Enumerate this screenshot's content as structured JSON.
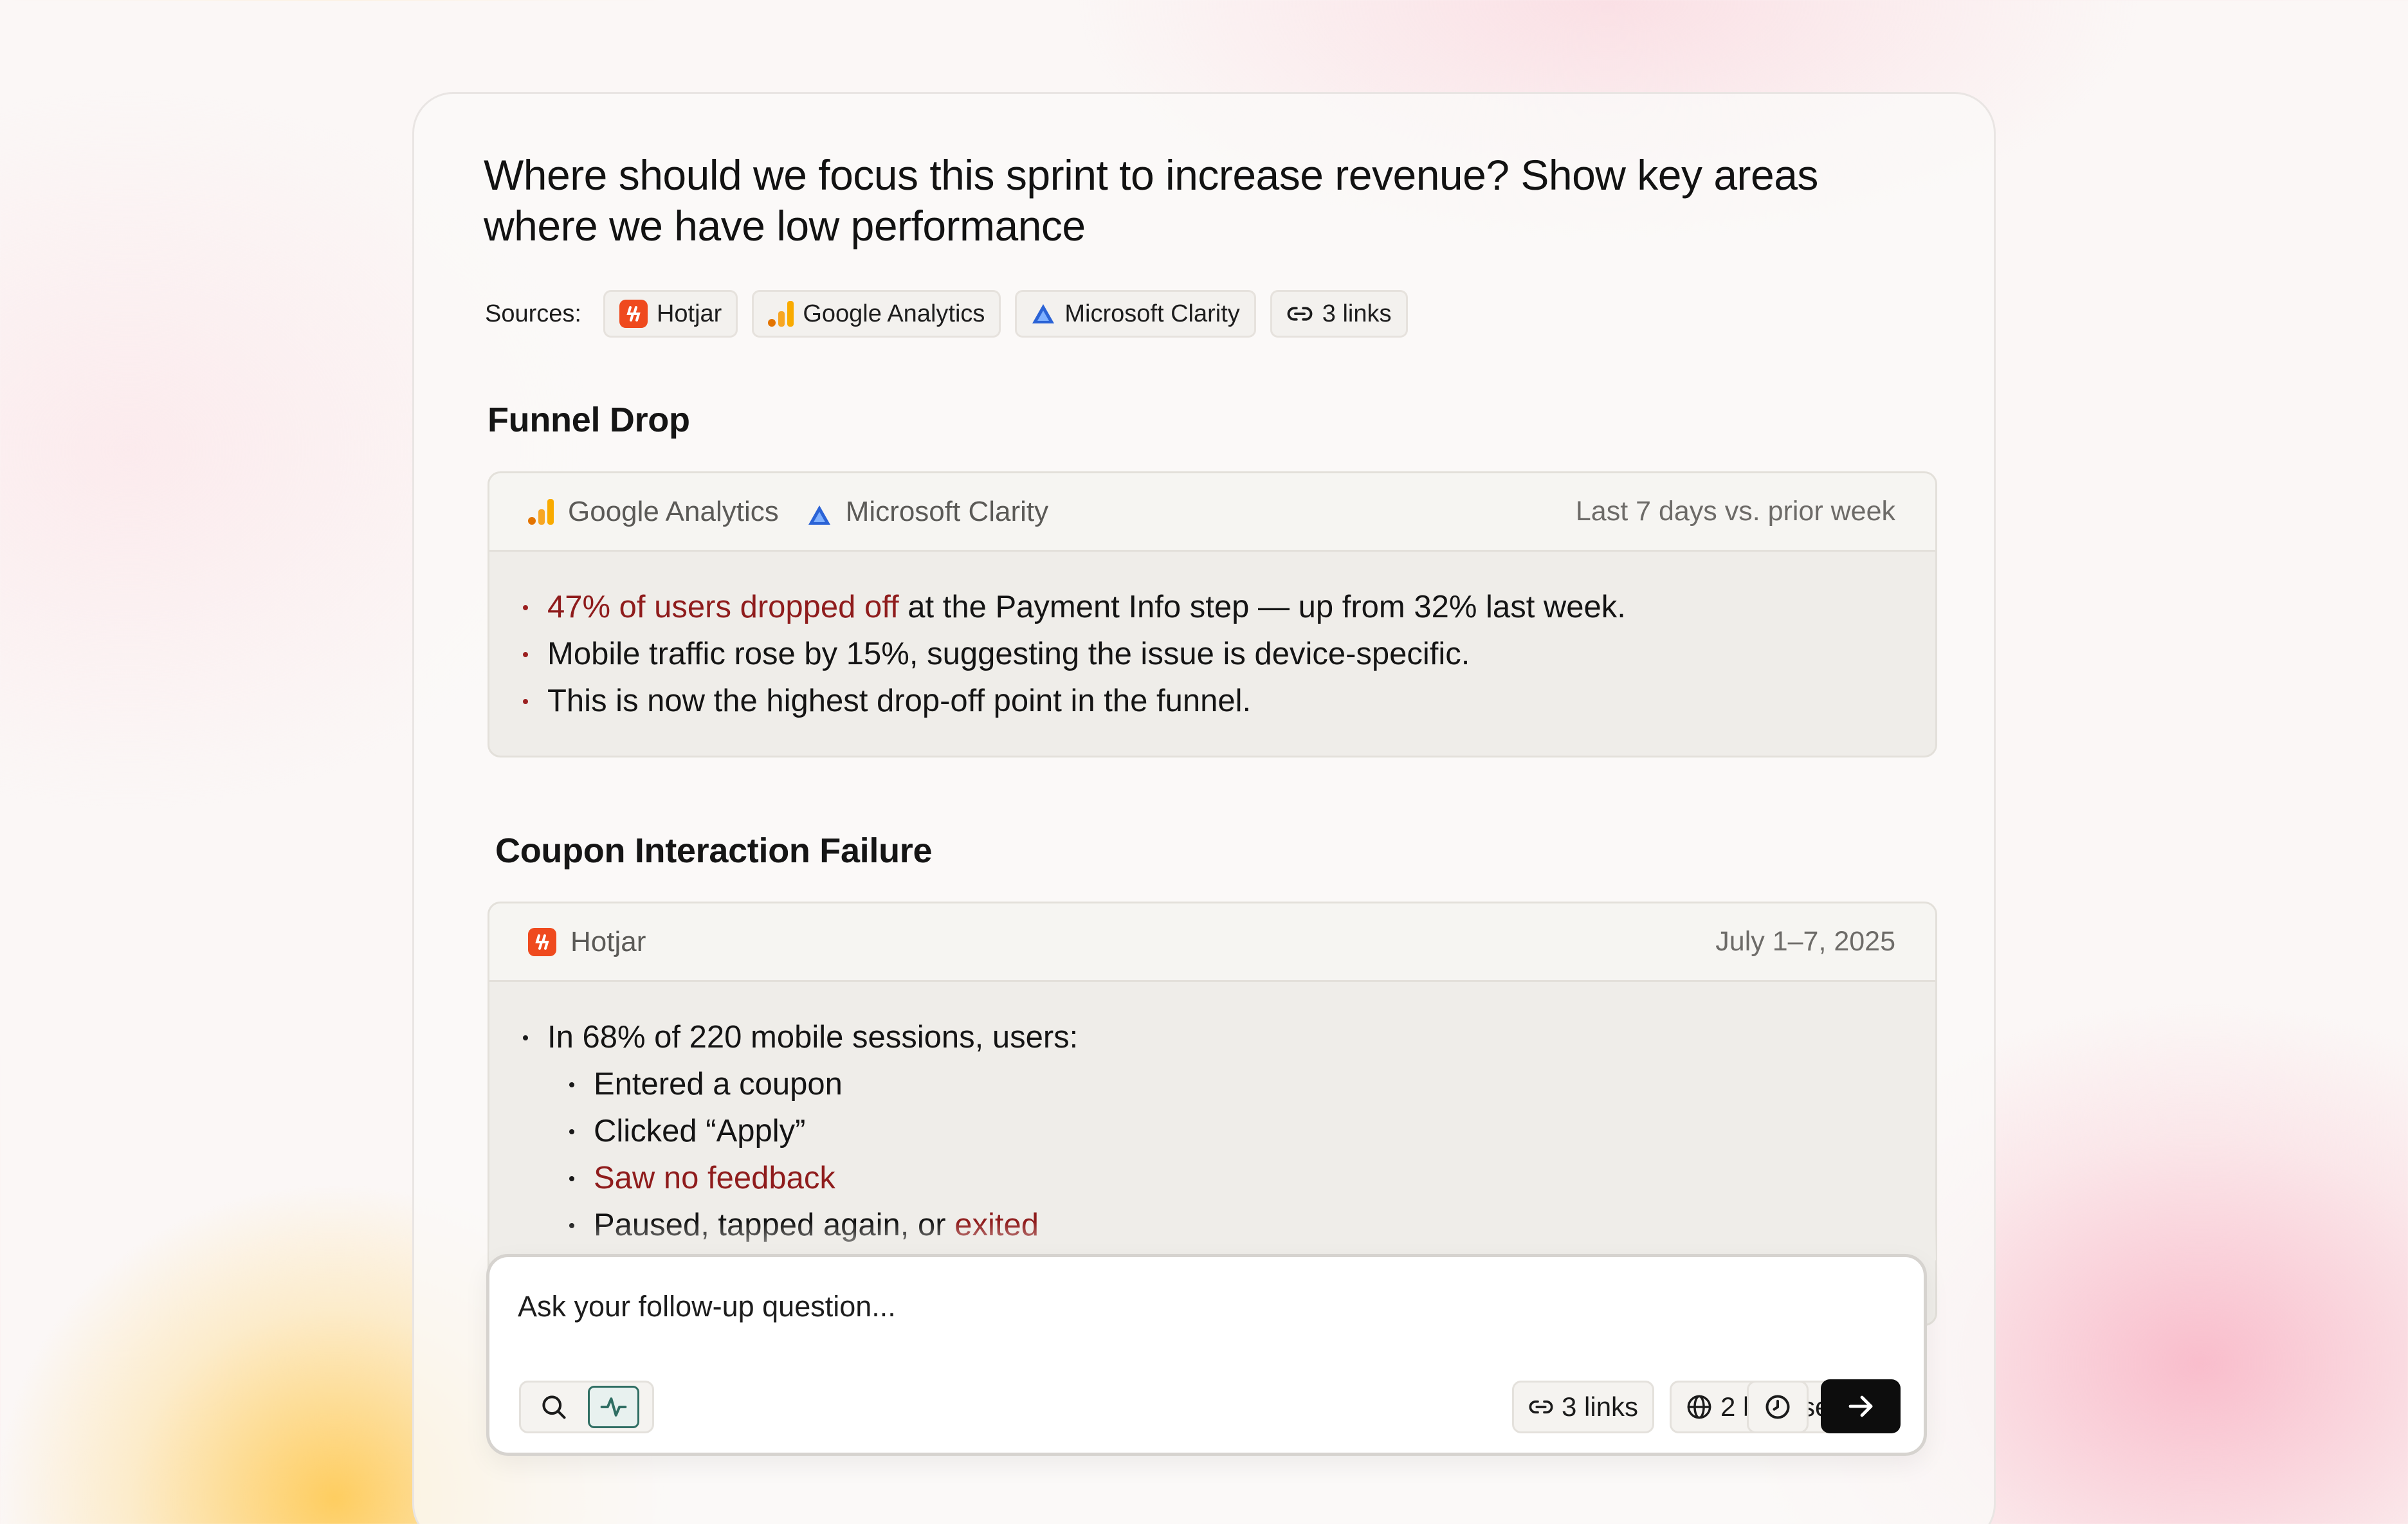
{
  "question": "Where should we focus this sprint to increase revenue? Show key areas where we have low performance",
  "sources": {
    "label": "Sources:",
    "items": [
      {
        "name": "Hotjar",
        "icon": "hotjar-logo"
      },
      {
        "name": "Google Analytics",
        "icon": "google-analytics-logo"
      },
      {
        "name": "Microsoft Clarity",
        "icon": "microsoft-clarity-logo"
      },
      {
        "name": "3 links",
        "icon": "link-icon"
      }
    ]
  },
  "sections": [
    {
      "title": "Funnel Drop",
      "sources": [
        "Google Analytics",
        "Microsoft Clarity"
      ],
      "period": "Last 7 days vs. prior week",
      "bullets": [
        {
          "highlight": "47% of users dropped off",
          "text": " at the Payment Info step — up from 32% last week."
        },
        {
          "text": "Mobile traffic rose by 15%, suggesting the issue is device-specific."
        },
        {
          "text": "This is now the highest drop-off point in the funnel."
        }
      ]
    },
    {
      "title": "Coupon Interaction Failure",
      "sources": [
        "Hotjar"
      ],
      "period": "July 1–7, 2025",
      "intro": "In 68% of 220 mobile sessions, users:",
      "sub_bullets": [
        {
          "text": "Entered a coupon"
        },
        {
          "text": "Clicked “Apply”"
        },
        {
          "highlight": "Saw no feedback"
        },
        {
          "text": "Paused, tapped again, or ",
          "highlight_end": "exited"
        }
      ]
    }
  ],
  "composer": {
    "placeholder": "Ask your follow-up question...",
    "links_label": "3 links",
    "browser_label": "2 browser",
    "icons": [
      "search-icon",
      "activity-icon",
      "link-icon",
      "globe-icon",
      "clock-icon",
      "arrow-right-icon"
    ]
  },
  "colors": {
    "accent_red": "#8f1c1c",
    "hotjar": "#ef4a1e",
    "google_analytics": "#f9ab00",
    "microsoft_clarity": "#2b63d6",
    "active_tool": "#2f6e63",
    "send_button": "#0d0d0d"
  }
}
